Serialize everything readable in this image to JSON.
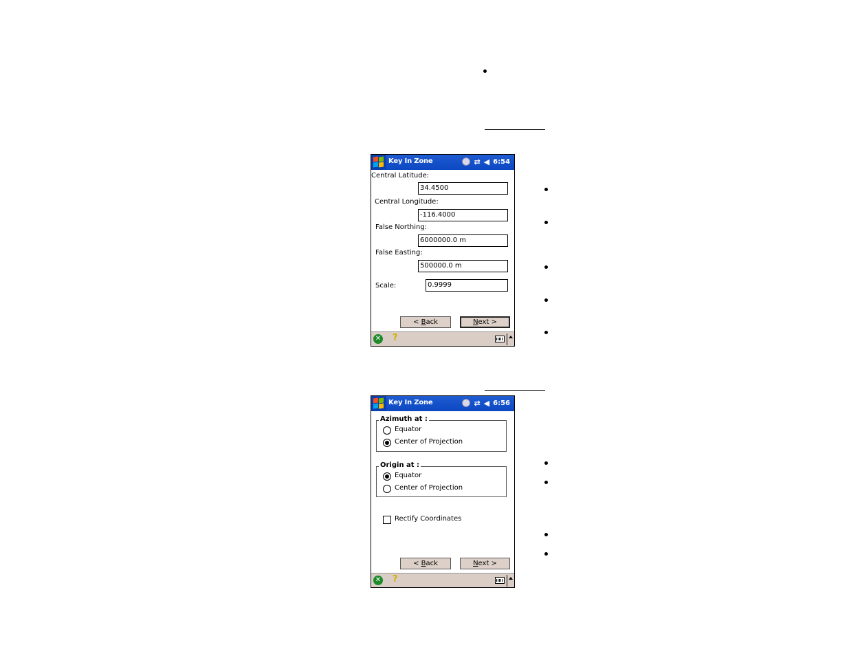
{
  "screen1": {
    "title": "Key In Zone",
    "time": "6:54",
    "fields": [
      {
        "label": "Central Latitude:",
        "value": "34.4500"
      },
      {
        "label": "Central Longitude:",
        "value": "-116.4000"
      },
      {
        "label": "False Northing:",
        "value": "6000000.0 m"
      },
      {
        "label": "False Easting:",
        "value": "500000.0 m"
      },
      {
        "label": "Scale:",
        "value": "0.9999"
      }
    ],
    "back_prefix": "< ",
    "back_mnemonic": "B",
    "back_rest": "ack",
    "next_mnemonic": "N",
    "next_rest": "ext >"
  },
  "screen2": {
    "title": "Key In Zone",
    "time": "6:56",
    "azimuth_group": {
      "label": "Azimuth at :",
      "options": [
        {
          "label": "Equator",
          "selected": false
        },
        {
          "label": "Center of Projection",
          "selected": true
        }
      ]
    },
    "origin_group": {
      "label": "Origin at :",
      "options": [
        {
          "label": "Equator",
          "selected": true
        },
        {
          "label": "Center of Projection",
          "selected": false
        }
      ]
    },
    "rectify_label": "Rectify Coordinates",
    "rectify_checked": false,
    "back_prefix": "< ",
    "back_mnemonic": "B",
    "back_rest": "ack",
    "next_mnemonic": "N",
    "next_rest": "ext >"
  },
  "icons": {
    "ok": "✕",
    "help": "?",
    "sync": "⇄",
    "volume": "◀"
  }
}
